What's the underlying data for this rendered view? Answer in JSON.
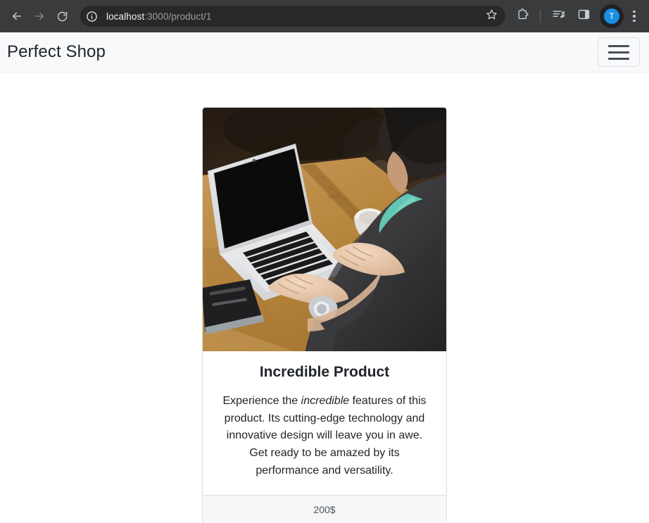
{
  "browser": {
    "back_icon": "back-arrow-icon",
    "forward_icon": "forward-arrow-icon",
    "reload_icon": "reload-icon",
    "site_info_icon": "site-info-circle-icon",
    "url_host": "localhost",
    "url_path": ":3000/product/1",
    "url_full": "localhost:3000/product/1",
    "bookmark_icon": "star-icon",
    "extensions_icon": "extensions-puzzle-icon",
    "media_icon": "media-playlist-icon",
    "side_panel_icon": "side-panel-icon",
    "profile_initial": "T",
    "profile_color": "#1a8fe3",
    "menu_icon": "three-dot-menu-icon",
    "chrome_bg": "#3a3b3c",
    "omnibox_bg": "#282828"
  },
  "site_nav": {
    "brand": "Perfect Shop",
    "toggler_icon": "hamburger-menu-icon",
    "bg": "#f8f9fa"
  },
  "product": {
    "image_alt": "person typing on a laptop at a wooden outdoor table",
    "title": "Incredible Product",
    "description_lead": "Experience the ",
    "description_emphasis": "incredible",
    "description_rest": " features of this product. Its cutting-edge technology and innovative design will leave you in awe. Get ready to be amazed by its performance and versatility.",
    "price": "200$"
  },
  "colors": {
    "card_border": "#dee2e6",
    "footer_bg": "#f7f7f8",
    "text": "#212529"
  }
}
